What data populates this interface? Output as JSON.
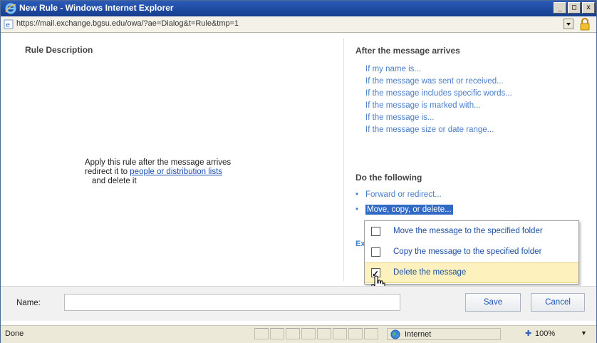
{
  "window": {
    "title": "New Rule - Windows Internet Explorer",
    "minimize": "_",
    "maximize": "□",
    "close": "x"
  },
  "address": {
    "url": "https://mail.exchange.bgsu.edu/owa/?ae=Dialog&t=Rule&tmp=1"
  },
  "left": {
    "heading": "Rule Description",
    "line1": "Apply this rule after the message arrives",
    "line2_prefix": "redirect it to ",
    "line2_link": "people or distribution lists",
    "line3": "and delete it"
  },
  "right": {
    "conditions_heading": "After the message arrives",
    "conditions": [
      "If my name is...",
      "If the message was sent or received...",
      "If the message includes specific words...",
      "If the message is marked with...",
      "If the message is...",
      "If the message size or date range..."
    ],
    "actions_heading": "Do the following",
    "actions": [
      "Forward or redirect...",
      "Move, copy, or delete..."
    ],
    "except_partial": "Ex"
  },
  "popup": {
    "items": [
      {
        "label": "Move the message to the specified folder",
        "checked": false
      },
      {
        "label": "Copy the message to the specified folder",
        "checked": false
      },
      {
        "label": "Delete the message",
        "checked": true
      }
    ]
  },
  "footer": {
    "name_label": "Name:",
    "name_value": "",
    "save_label": "Save",
    "cancel_label": "Cancel"
  },
  "statusbar": {
    "status": "Done",
    "zone": "Internet",
    "zoom": "100%"
  },
  "colors": {
    "link": "#4a7ec7",
    "title_bar": "#1f4aa0",
    "highlight": "#316ac5",
    "popup_hover": "#fdf2bd"
  }
}
